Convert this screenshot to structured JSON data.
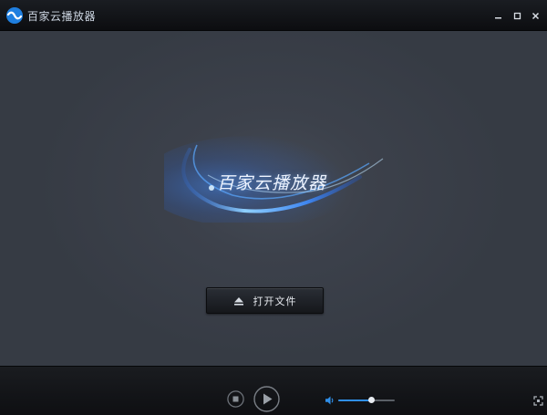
{
  "window": {
    "title": "百家云播放器"
  },
  "titlebar": {
    "minimize_icon": "minimize-icon",
    "maximize_icon": "maximize-icon",
    "close_icon": "close-icon"
  },
  "stage": {
    "splash_title": "百家云播放器",
    "open_file_label": "打开文件",
    "open_file_icon": "eject-icon"
  },
  "controls": {
    "stop_icon": "stop-icon",
    "play_icon": "play-icon",
    "volume_icon": "volume-icon",
    "volume_level": 0.58,
    "fullscreen_icon": "fullscreen-icon"
  },
  "colors": {
    "accent": "#2f8fe8",
    "background": "#363b44",
    "bar": "#0e0f12"
  }
}
